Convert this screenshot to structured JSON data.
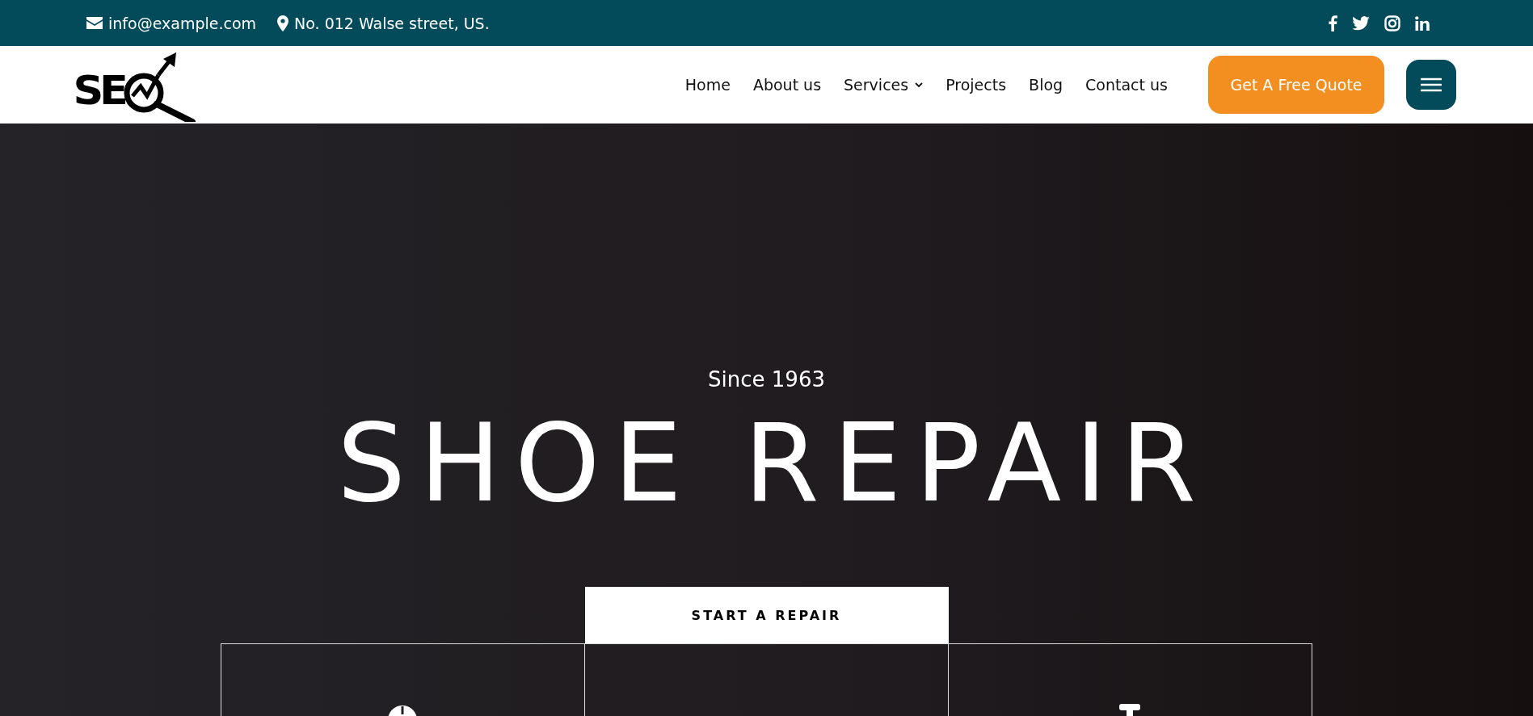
{
  "top_bar": {
    "email": "info@example.com",
    "address": "No. 012 Walse street, US."
  },
  "header": {
    "logo_text": "SE",
    "nav": [
      {
        "label": "Home",
        "has_dropdown": false
      },
      {
        "label": "About us",
        "has_dropdown": false
      },
      {
        "label": "Services",
        "has_dropdown": true
      },
      {
        "label": "Projects",
        "has_dropdown": false
      },
      {
        "label": "Blog",
        "has_dropdown": false
      },
      {
        "label": "Contact us",
        "has_dropdown": false
      }
    ],
    "cta": "Get A Free Quote"
  },
  "hero": {
    "subtitle": "Since 1963",
    "title": "SHOE REPAIR",
    "button": "START A REPAIR",
    "features": [
      {
        "kind": "round"
      },
      {
        "kind": "empty"
      },
      {
        "kind": "post"
      }
    ]
  }
}
